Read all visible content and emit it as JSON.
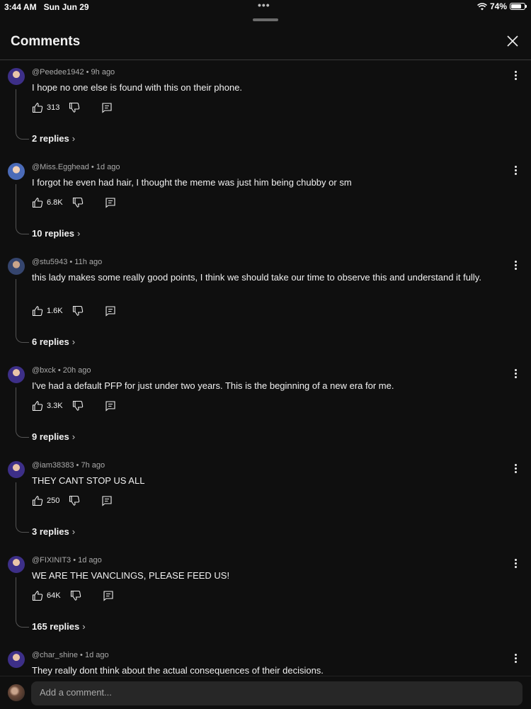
{
  "status": {
    "time": "3:44 AM",
    "date": "Sun Jun 29",
    "battery": "74%"
  },
  "header": {
    "title": "Comments"
  },
  "comments": [
    {
      "author": "@Peedee1942",
      "age": "9h ago",
      "text": "I hope no one else is found with this on their phone.",
      "likes": "313",
      "replies": "2 replies"
    },
    {
      "author": "@Miss.Egghead",
      "age": "1d ago",
      "text": "I forgot he even had hair, I thought the meme was just him being chubby or sm",
      "likes": "6.8K",
      "replies": "10 replies"
    },
    {
      "author": "@stu5943",
      "age": "11h ago",
      "text": "this lady makes some really good points, I think we should take our time to observe this and understand it fully.",
      "likes": "1.6K",
      "replies": "6 replies"
    },
    {
      "author": "@bxck",
      "age": "20h ago",
      "text": "I've had a default PFP for just under two years. This is the beginning of a new era for me.",
      "likes": "3.3K",
      "replies": "9 replies"
    },
    {
      "author": "@iam38383",
      "age": "7h ago",
      "text": "THEY CANT STOP US ALL",
      "likes": "250",
      "replies": "3 replies"
    },
    {
      "author": "@FIXINIT3",
      "age": "1d ago",
      "text": "WE ARE THE VANCLINGS, PLEASE FEED US!",
      "likes": "64K",
      "replies": "165 replies"
    },
    {
      "author": "@char_shine",
      "age": "1d ago",
      "text": "They really dont think about the actual consequences of their decisions.",
      "likes": "",
      "replies": ""
    }
  ],
  "composer": {
    "placeholder": "Add a comment..."
  },
  "icons": {
    "like": "thumbs-up-icon",
    "dislike": "thumbs-down-icon",
    "reply": "reply-icon",
    "more": "kebab-icon",
    "close": "close-icon",
    "wifi": "wifi-icon",
    "battery": "battery-icon"
  }
}
